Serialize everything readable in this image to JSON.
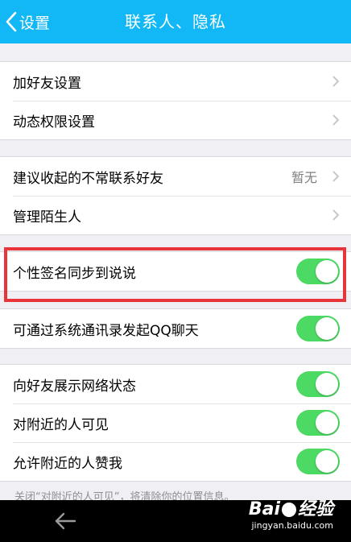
{
  "header": {
    "back_label": "设置",
    "title": "联系人、隐私"
  },
  "groups": {
    "g1": {
      "add_friend": "加好友设置",
      "feed_permission": "动态权限设置"
    },
    "g2": {
      "collapse_infrequent": "建议收起的不常联系好友",
      "collapse_value": "暂无",
      "manage_strangers": "管理陌生人"
    },
    "g3": {
      "sync_signature": "个性签名同步到说说",
      "sync_signature_on": true
    },
    "g4": {
      "contacts_chat": "可通过系统通讯录发起QQ聊天",
      "contacts_chat_on": true
    },
    "g5": {
      "show_network": "向好友展示网络状态",
      "show_network_on": true,
      "visible_nearby": "对附近的人可见",
      "visible_nearby_on": true,
      "nearby_like": "允许附近的人赞我",
      "nearby_like_on": true
    }
  },
  "footnote": "关闭“对附近的人可见”，将清除你的位置信息。",
  "watermark": {
    "brand_left": "Bai",
    "brand_right": "经验",
    "url": "jingyan.baidu.com"
  },
  "colors": {
    "titlebar": "#12b7f5",
    "toggle_on": "#4cd964",
    "highlight": "#e8353b"
  }
}
